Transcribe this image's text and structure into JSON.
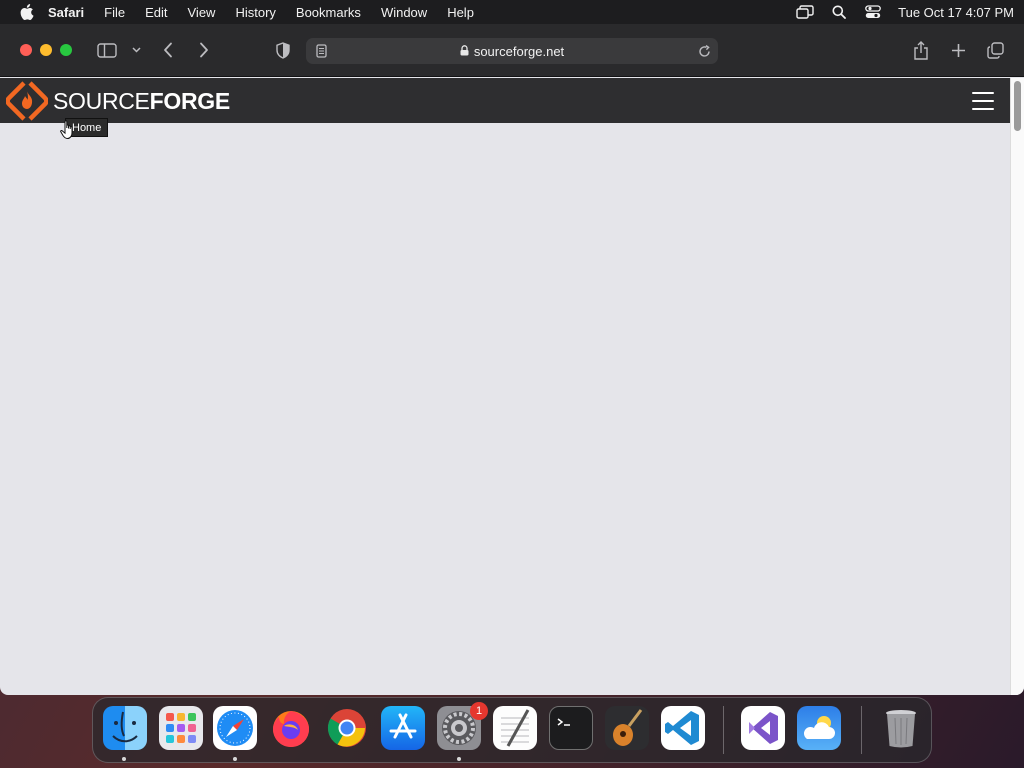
{
  "menubar": {
    "app_name": "Safari",
    "items": [
      "File",
      "Edit",
      "View",
      "History",
      "Bookmarks",
      "Window",
      "Help"
    ],
    "clock": "Tue Oct 17  4:07 PM"
  },
  "browser": {
    "url": "sourceforge.net"
  },
  "site": {
    "logo_light": "SOURCE",
    "logo_bold": "FORGE",
    "tooltip": "Home"
  },
  "dock": {
    "apps": [
      "Finder",
      "Launchpad",
      "Safari",
      "Firefox",
      "Google Chrome",
      "App Store",
      "System Settings",
      "TextEdit",
      "Terminal",
      "GarageBand",
      "Visual Studio Code",
      "Visual Studio",
      "Weather",
      "Trash"
    ],
    "settings_badge": "1"
  },
  "colors": {
    "sourceforge_orange": "#f26822",
    "page_background": "#e5e5ea",
    "header_background": "#2e2e30"
  }
}
